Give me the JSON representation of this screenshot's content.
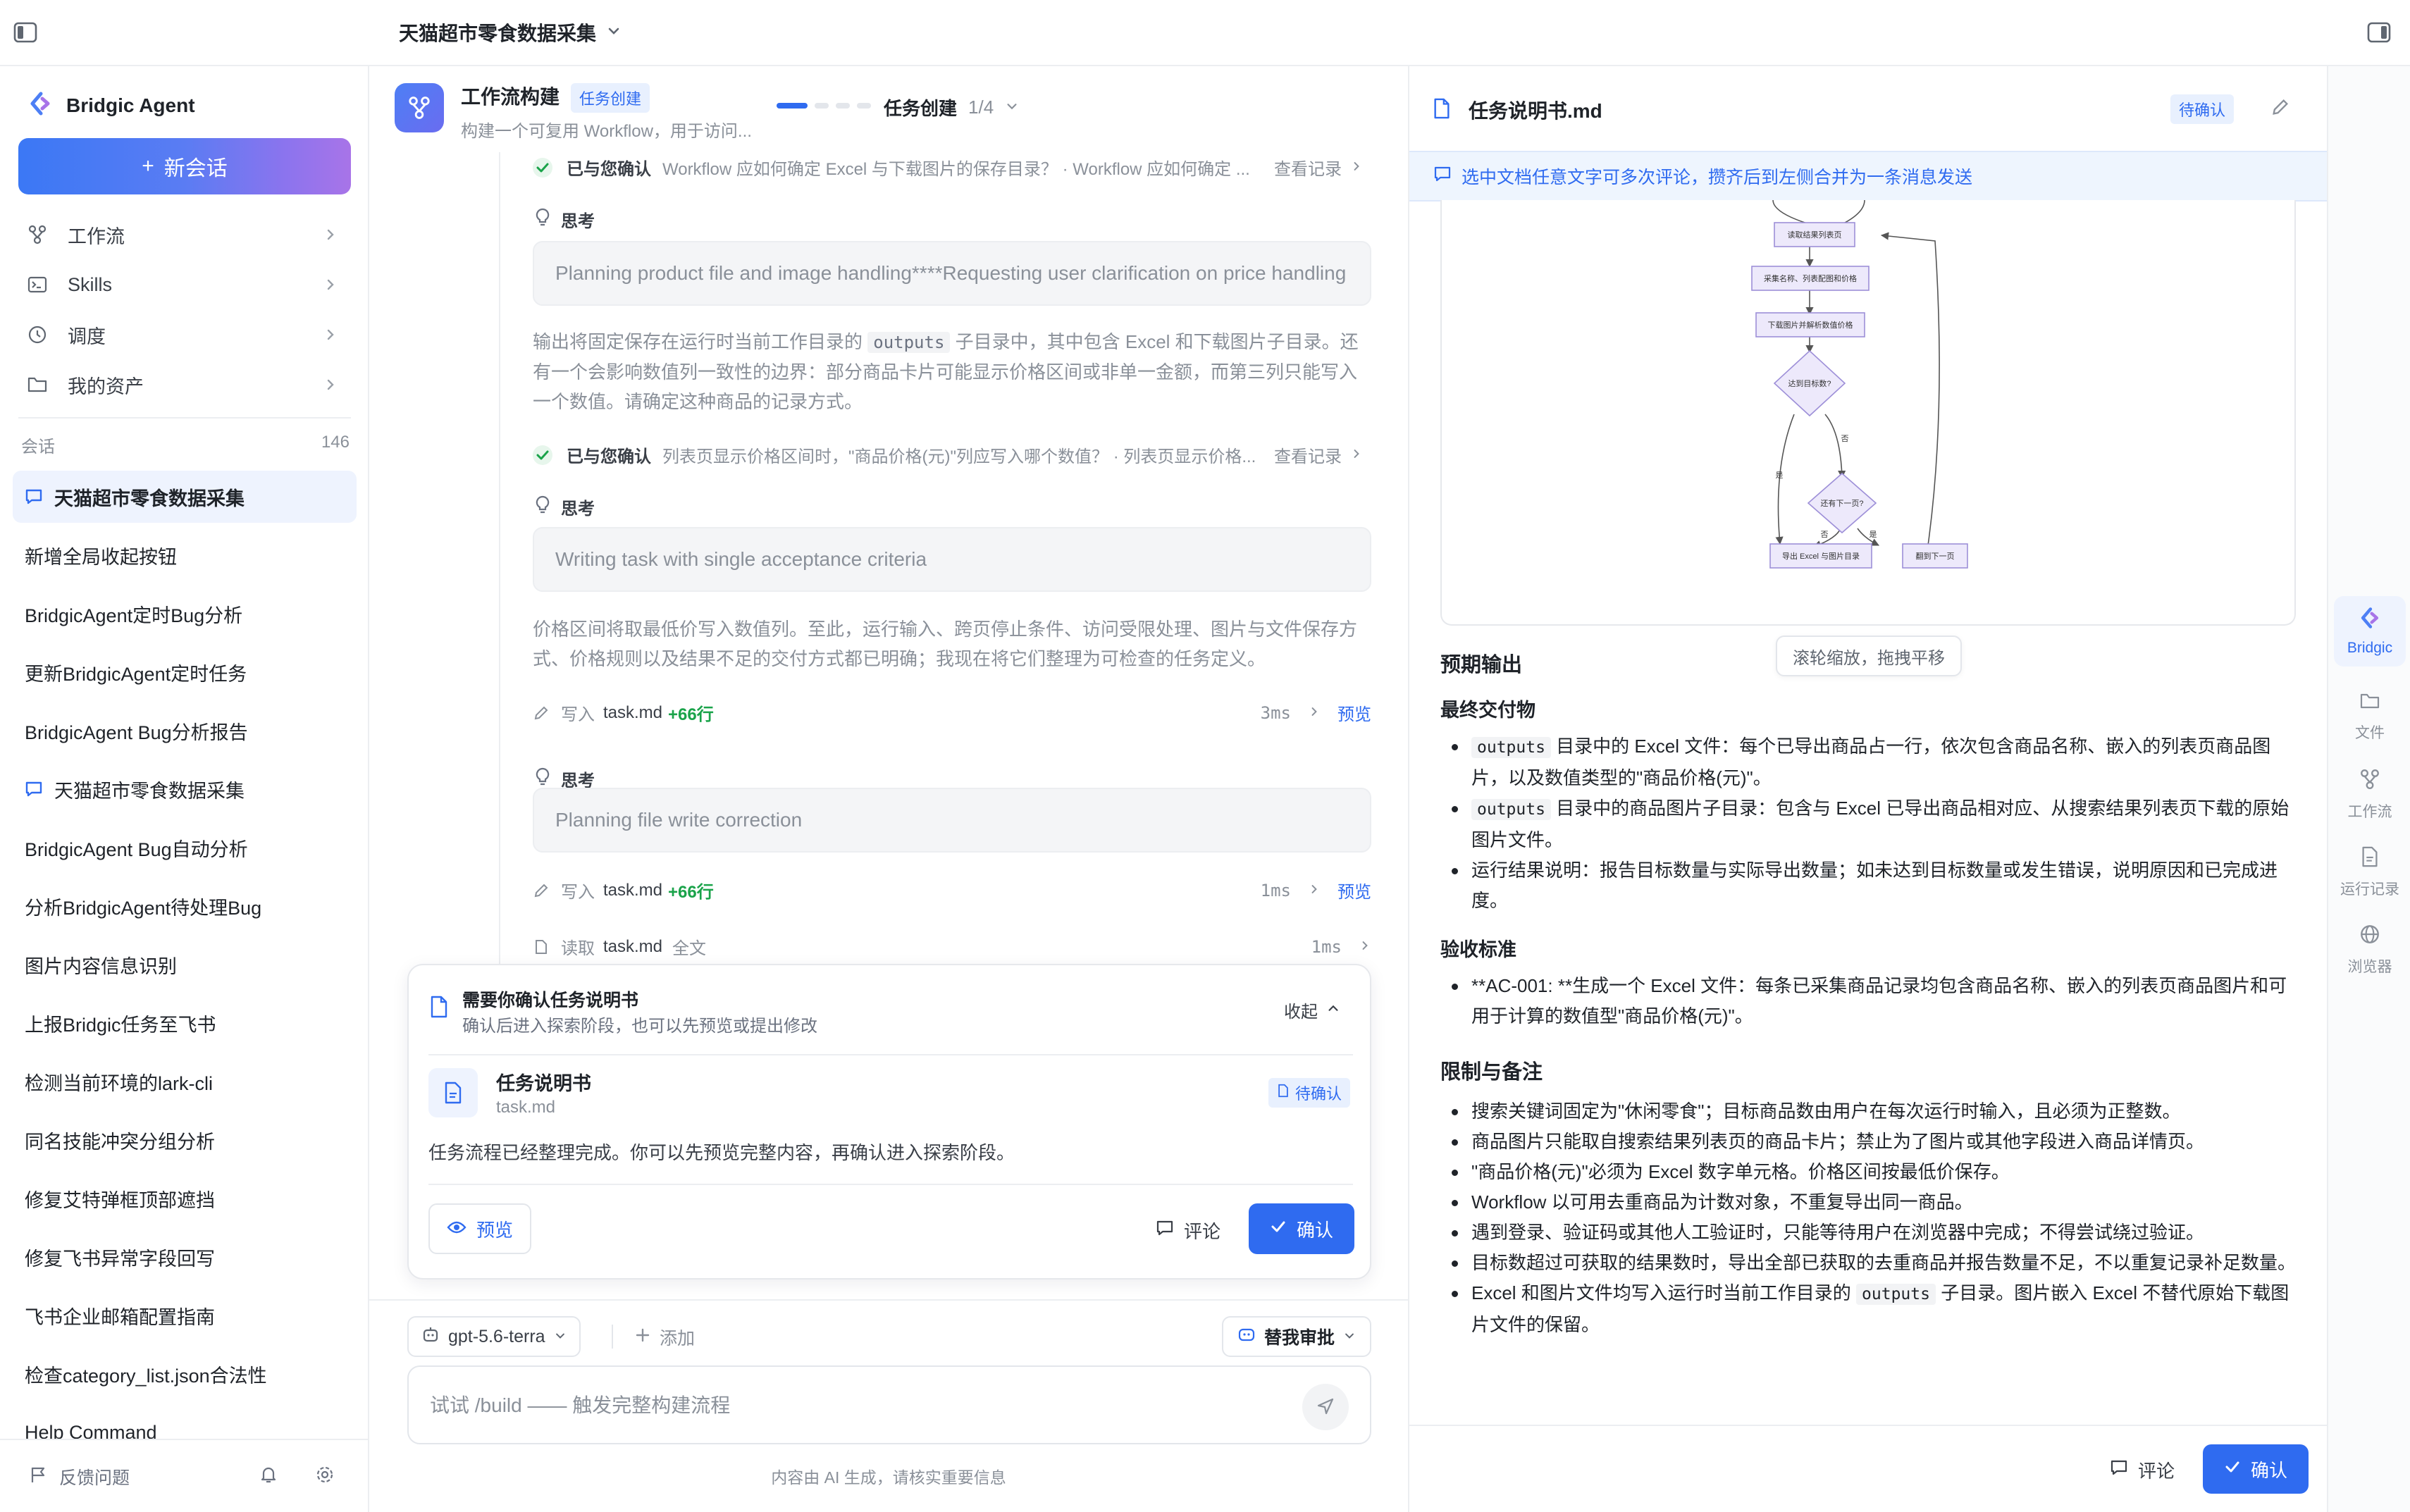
{
  "topbar": {
    "title": "天猫超市零食数据采集"
  },
  "sidebar": {
    "brand": "Bridgic Agent",
    "new_chat": "新会话",
    "nav": [
      {
        "label": "工作流",
        "icon": "workflow-icon"
      },
      {
        "label": "Skills",
        "icon": "terminal-icon"
      },
      {
        "label": "调度",
        "icon": "clock-icon"
      },
      {
        "label": "我的资产",
        "icon": "folder-icon"
      }
    ],
    "section_label": "会话",
    "section_count": "146",
    "conversations": [
      "天猫超市零食数据采集",
      "新增全局收起按钮",
      "BridgicAgent定时Bug分析",
      "更新BridgicAgent定时任务",
      "BridgicAgent Bug分析报告",
      "天猫超市零食数据采集",
      "BridgicAgent Bug自动分析",
      "分析BridgicAgent待处理Bug",
      "图片内容信息识别",
      "上报Bridgic任务至飞书",
      "检测当前环境的lark-cli",
      "同名技能冲突分组分析",
      "修复艾特弹框顶部遮挡",
      "修复飞书异常字段回写",
      "飞书企业邮箱配置指南",
      "检查category_list.json合法性",
      "Help Command"
    ],
    "feedback": "反馈问题"
  },
  "chat": {
    "title": "工作流构建",
    "tag": "任务创建",
    "subtitle": "构建一个可复用 Workflow，用于访问...",
    "step_label": "任务创建",
    "step_fraction": "1/4",
    "confirm1": {
      "label": "已与您确认",
      "question": "Workflow 应如何确定 Excel 与下载图片的保存目录？ · Workflow 应如何确定 ...",
      "link": "查看记录"
    },
    "think_label": "思考",
    "think1": "Planning product file and image handling****Requesting user clarification on price handling",
    "para1_a": "输出将固定保存在运行时当前工作目录的",
    "para1_code": "outputs",
    "para1_b": "子目录中，其中包含 Excel 和下载图片子目录。还有一个会影响数值列一致性的边界：部分商品卡片可能显示价格区间或非单一金额，而第三列只能写入一个数值。请确定这种商品的记录方式。",
    "confirm2": {
      "label": "已与您确认",
      "question": "列表页显示价格区间时，\"商品价格(元)\"列应写入哪个数值？ · 列表页显示价格...",
      "link": "查看记录"
    },
    "think2": "Writing task with single acceptance criteria",
    "para2": "价格区间将取最低价写入数值列。至此，运行输入、跨页停止条件、访问受限处理、图片与文件保存方式、价格规则以及结果不足的交付方式都已明确；我现在将它们整理为可检查的任务定义。",
    "write1": {
      "verb": "写入",
      "file": "task.md",
      "delta": "+66行",
      "time": "3ms",
      "preview": "预览"
    },
    "think3": "Planning file write correction",
    "write2": {
      "verb": "写入",
      "file": "task.md",
      "delta": "+66行",
      "time": "1ms",
      "preview": "预览"
    },
    "read1": {
      "verb": "读取",
      "file": "task.md",
      "scope": "全文",
      "time": "1ms"
    },
    "card": {
      "title": "需要你确认任务说明书",
      "subtitle": "确认后进入探索阶段，也可以先预览或提出修改",
      "collapse": "收起",
      "doc_title": "任务说明书",
      "doc_file": "task.md",
      "doc_status": "待确认",
      "body": "任务流程已经整理完成。你可以先预览完整内容，再确认进入探索阶段。",
      "preview": "预览",
      "comment": "评论",
      "confirm": "确认"
    },
    "model": "gpt-5.6-terra",
    "add": "添加",
    "approve": "替我审批",
    "input_placeholder": "试试 /build —— 触发完整构建流程",
    "disclaimer": "内容由 AI 生成，请核实重要信息"
  },
  "doc": {
    "title": "任务说明书.md",
    "status": "待确认",
    "tip": "选中文档任意文字可多次评论，攒齐后到左侧合并为一条消息发送",
    "flow": {
      "n1": "读取结果列表页",
      "n2": "采集名称、列表配图和价格",
      "n3": "下载图片并解析数值价格",
      "d1": "达到目标数?",
      "d2": "还有下一页?",
      "e_yes": "是",
      "e_no": "否",
      "end1": "导出 Excel 与图片目录",
      "end2": "翻到下一页"
    },
    "zoom_hint": "滚轮缩放，拖拽平移",
    "h_output": "预期输出",
    "h_deliver": "最终交付物",
    "deliver": [
      {
        "code": "outputs",
        "text": "目录中的 Excel 文件：每个已导出商品占一行，依次包含商品名称、嵌入的列表页商品图片，以及数值类型的\"商品价格(元)\"。"
      },
      {
        "code": "outputs",
        "text": "目录中的商品图片子目录：包含与 Excel 已导出商品相对应、从搜索结果列表页下载的原始图片文件。"
      },
      {
        "code": "",
        "text": "运行结果说明：报告目标数量与实际导出数量；如未达到目标数量或发生错误，说明原因和已完成进度。"
      }
    ],
    "h_accept": "验收标准",
    "accept": [
      "**AC-001: **生成一个 Excel 文件：每条已采集商品记录均包含商品名称、嵌入的列表页商品图片和可用于计算的数值型\"商品价格(元)\"。"
    ],
    "h_limits": "限制与备注",
    "limits": [
      "搜索关键词固定为\"休闲零食\"；目标商品数由用户在每次运行时输入，且必须为正整数。",
      "商品图片只能取自搜索结果列表页的商品卡片；禁止为了图片或其他字段进入商品详情页。",
      "\"商品价格(元)\"必须为 Excel 数字单元格。价格区间按最低价保存。",
      "Workflow 以可用去重商品为计数对象，不重复导出同一商品。",
      "遇到登录、验证码或其他人工验证时，只能等待用户在浏览器中完成；不得尝试绕过验证。",
      "目标数超过可获取的结果数时，导出全部已获取的去重商品并报告数量不足，不以重复记录补足数量。"
    ],
    "last_a": "Excel 和图片文件均写入运行时当前工作目录的",
    "last_code": "outputs",
    "last_b": "子目录。图片嵌入 Excel 不替代原始下载图片文件的保留。",
    "comment": "评论",
    "confirm": "确认"
  },
  "rail": [
    {
      "label": "Bridgic"
    },
    {
      "label": "文件"
    },
    {
      "label": "工作流"
    },
    {
      "label": "运行记录"
    },
    {
      "label": "浏览器"
    }
  ],
  "colors": {
    "accent": "#2f6bf0",
    "success": "#1aa34a",
    "muted": "#8a9099",
    "tip_bg": "#eef5fe",
    "flow_node": "#ede9fb",
    "flow_stroke": "#9d8fd8"
  }
}
